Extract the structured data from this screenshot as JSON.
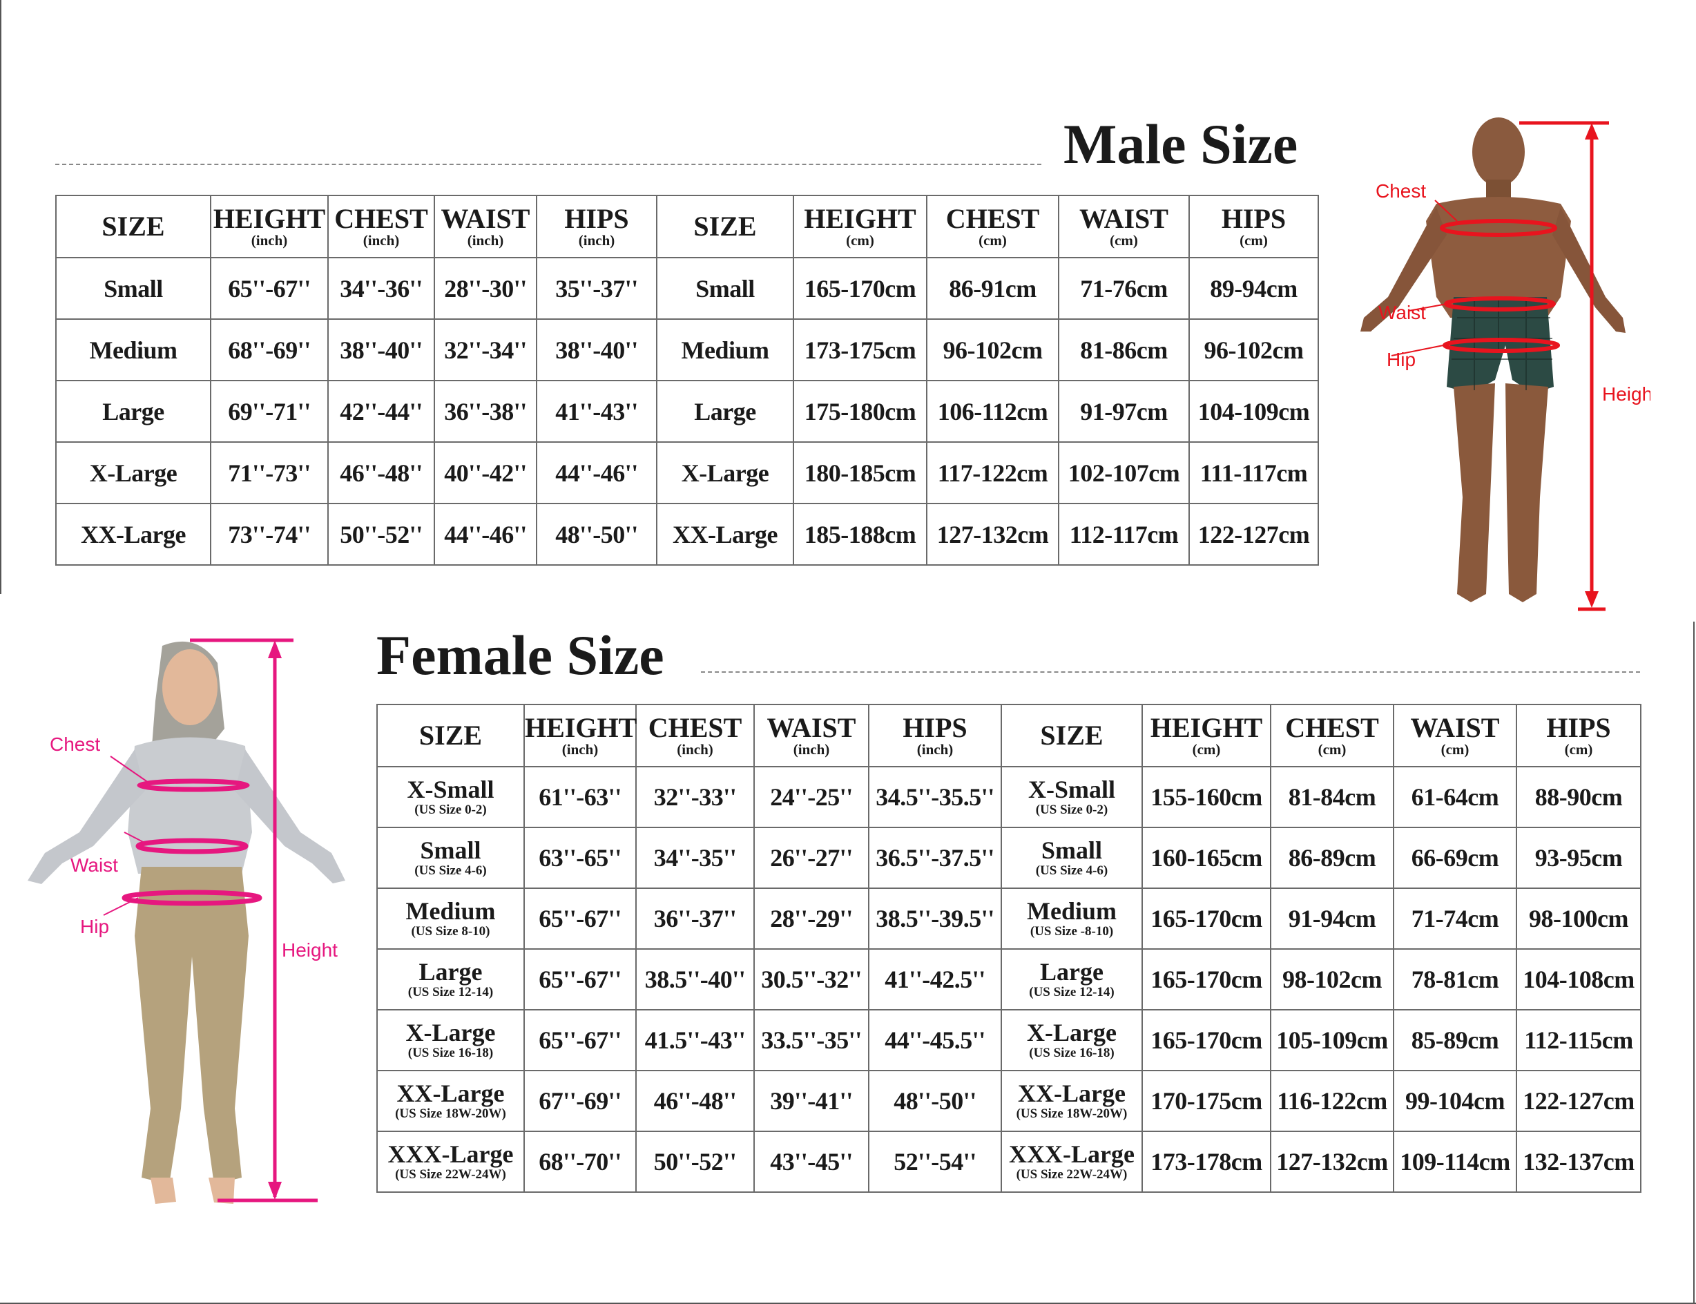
{
  "male": {
    "title": "Male Size",
    "headers": [
      {
        "name": "SIZE",
        "unit": ""
      },
      {
        "name": "HEIGHT",
        "unit": "(inch)"
      },
      {
        "name": "CHEST",
        "unit": "(inch)"
      },
      {
        "name": "WAIST",
        "unit": "(inch)"
      },
      {
        "name": "HIPS",
        "unit": "(inch)"
      },
      {
        "name": "SIZE",
        "unit": ""
      },
      {
        "name": "HEIGHT",
        "unit": "(cm)"
      },
      {
        "name": "CHEST",
        "unit": "(cm)"
      },
      {
        "name": "WAIST",
        "unit": "(cm)"
      },
      {
        "name": "HIPS",
        "unit": "(cm)"
      }
    ],
    "rows": [
      {
        "size": "Small",
        "height_in": "65''-67''",
        "chest_in": "34''-36''",
        "waist_in": "28''-30''",
        "hips_in": "35''-37''",
        "size2": "Small",
        "height_cm": "165-170cm",
        "chest_cm": "86-91cm",
        "waist_cm": "71-76cm",
        "hips_cm": "89-94cm"
      },
      {
        "size": "Medium",
        "height_in": "68''-69''",
        "chest_in": "38''-40''",
        "waist_in": "32''-34''",
        "hips_in": "38''-40''",
        "size2": "Medium",
        "height_cm": "173-175cm",
        "chest_cm": "96-102cm",
        "waist_cm": "81-86cm",
        "hips_cm": "96-102cm"
      },
      {
        "size": "Large",
        "height_in": "69''-71''",
        "chest_in": "42''-44''",
        "waist_in": "36''-38''",
        "hips_in": "41''-43''",
        "size2": "Large",
        "height_cm": "175-180cm",
        "chest_cm": "106-112cm",
        "waist_cm": "91-97cm",
        "hips_cm": "104-109cm"
      },
      {
        "size": "X-Large",
        "height_in": "71''-73''",
        "chest_in": "46''-48''",
        "waist_in": "40''-42''",
        "hips_in": "44''-46''",
        "size2": "X-Large",
        "height_cm": "180-185cm",
        "chest_cm": "117-122cm",
        "waist_cm": "102-107cm",
        "hips_cm": "111-117cm"
      },
      {
        "size": "XX-Large",
        "height_in": "73''-74''",
        "chest_in": "50''-52''",
        "waist_in": "44''-46''",
        "hips_in": "48''-50''",
        "size2": "XX-Large",
        "height_cm": "185-188cm",
        "chest_cm": "127-132cm",
        "waist_cm": "112-117cm",
        "hips_cm": "122-127cm"
      }
    ],
    "figure": {
      "chest_label": "Chest",
      "waist_label": "Waist",
      "hip_label": "Hip",
      "height_label": "Height",
      "marker_color": "#e8141e"
    }
  },
  "female": {
    "title": "Female Size",
    "headers": [
      {
        "name": "SIZE",
        "unit": ""
      },
      {
        "name": "HEIGHT",
        "unit": "(inch)"
      },
      {
        "name": "CHEST",
        "unit": "(inch)"
      },
      {
        "name": "WAIST",
        "unit": "(inch)"
      },
      {
        "name": "HIPS",
        "unit": "(inch)"
      },
      {
        "name": "SIZE",
        "unit": ""
      },
      {
        "name": "HEIGHT",
        "unit": "(cm)"
      },
      {
        "name": "CHEST",
        "unit": "(cm)"
      },
      {
        "name": "WAIST",
        "unit": "(cm)"
      },
      {
        "name": "HIPS",
        "unit": "(cm)"
      }
    ],
    "rows": [
      {
        "size": "X-Small",
        "us": "(US Size 0-2)",
        "height_in": "61''-63''",
        "chest_in": "32''-33''",
        "waist_in": "24''-25''",
        "hips_in": "34.5''-35.5''",
        "size2": "X-Small",
        "us2": "(US Size 0-2)",
        "height_cm": "155-160cm",
        "chest_cm": "81-84cm",
        "waist_cm": "61-64cm",
        "hips_cm": "88-90cm"
      },
      {
        "size": "Small",
        "us": "(US Size 4-6)",
        "height_in": "63''-65''",
        "chest_in": "34''-35''",
        "waist_in": "26''-27''",
        "hips_in": "36.5''-37.5''",
        "size2": "Small",
        "us2": "(US Size 4-6)",
        "height_cm": "160-165cm",
        "chest_cm": "86-89cm",
        "waist_cm": "66-69cm",
        "hips_cm": "93-95cm"
      },
      {
        "size": "Medium",
        "us": "(US Size 8-10)",
        "height_in": "65''-67''",
        "chest_in": "36''-37''",
        "waist_in": "28''-29''",
        "hips_in": "38.5''-39.5''",
        "size2": "Medium",
        "us2": "(US Size -8-10)",
        "height_cm": "165-170cm",
        "chest_cm": "91-94cm",
        "waist_cm": "71-74cm",
        "hips_cm": "98-100cm"
      },
      {
        "size": "Large",
        "us": "(US Size 12-14)",
        "height_in": "65''-67''",
        "chest_in": "38.5''-40''",
        "waist_in": "30.5''-32''",
        "hips_in": "41''-42.5''",
        "size2": "Large",
        "us2": "(US Size 12-14)",
        "height_cm": "165-170cm",
        "chest_cm": "98-102cm",
        "waist_cm": "78-81cm",
        "hips_cm": "104-108cm"
      },
      {
        "size": "X-Large",
        "us": "(US Size 16-18)",
        "height_in": "65''-67''",
        "chest_in": "41.5''-43''",
        "waist_in": "33.5''-35''",
        "hips_in": "44''-45.5''",
        "size2": "X-Large",
        "us2": "(US Size 16-18)",
        "height_cm": "165-170cm",
        "chest_cm": "105-109cm",
        "waist_cm": "85-89cm",
        "hips_cm": "112-115cm"
      },
      {
        "size": "XX-Large",
        "us": "(US Size 18W-20W)",
        "height_in": "67''-69''",
        "chest_in": "46''-48''",
        "waist_in": "39''-41''",
        "hips_in": "48''-50''",
        "size2": "XX-Large",
        "us2": "(US Size 18W-20W)",
        "height_cm": "170-175cm",
        "chest_cm": "116-122cm",
        "waist_cm": "99-104cm",
        "hips_cm": "122-127cm"
      },
      {
        "size": "XXX-Large",
        "us": "(US Size 22W-24W)",
        "height_in": "68''-70''",
        "chest_in": "50''-52''",
        "waist_in": "43''-45''",
        "hips_in": "52''-54''",
        "size2": "XXX-Large",
        "us2": "(US Size 22W-24W)",
        "height_cm": "173-178cm",
        "chest_cm": "127-132cm",
        "waist_cm": "109-114cm",
        "hips_cm": "132-137cm"
      }
    ],
    "figure": {
      "chest_label": "Chest",
      "waist_label": "Waist",
      "hip_label": "Hip",
      "height_label": "Height",
      "marker_color": "#e6177f"
    }
  }
}
